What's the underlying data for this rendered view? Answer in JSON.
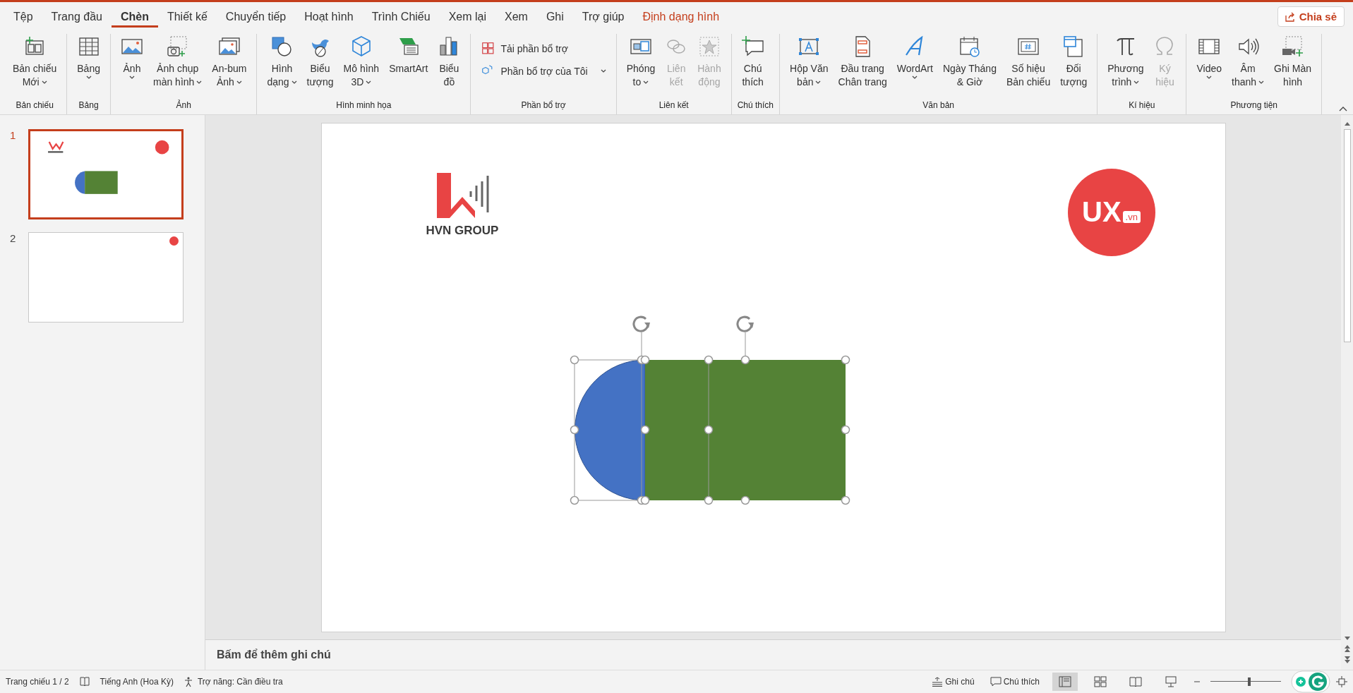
{
  "menu_tabs": [
    {
      "label": "Tệp",
      "selected": false,
      "kind": "normal"
    },
    {
      "label": "Trang đầu",
      "selected": false,
      "kind": "normal"
    },
    {
      "label": "Chèn",
      "selected": true,
      "kind": "normal"
    },
    {
      "label": "Thiết kế",
      "selected": false,
      "kind": "normal"
    },
    {
      "label": "Chuyển tiếp",
      "selected": false,
      "kind": "normal"
    },
    {
      "label": "Hoạt hình",
      "selected": false,
      "kind": "normal"
    },
    {
      "label": "Trình Chiếu",
      "selected": false,
      "kind": "normal"
    },
    {
      "label": "Xem lại",
      "selected": false,
      "kind": "normal"
    },
    {
      "label": "Xem",
      "selected": false,
      "kind": "normal"
    },
    {
      "label": "Ghi",
      "selected": false,
      "kind": "normal"
    },
    {
      "label": "Trợ giúp",
      "selected": false,
      "kind": "normal"
    },
    {
      "label": "Định dạng hình",
      "selected": false,
      "kind": "contextual"
    }
  ],
  "share_button": "Chia sẻ",
  "ribbon": {
    "groups": [
      {
        "label": "Bản chiếu",
        "items": [
          {
            "kind": "large",
            "lines": [
              "Bản chiếu",
              "Mới"
            ],
            "dropdown": true,
            "disabled": false
          }
        ]
      },
      {
        "label": "Bảng",
        "items": [
          {
            "kind": "large",
            "lines": [
              "Bảng"
            ],
            "dropdown": true,
            "disabled": false
          }
        ]
      },
      {
        "label": "Ảnh",
        "items": [
          {
            "kind": "large",
            "lines": [
              "Ảnh"
            ],
            "dropdown": true,
            "disabled": false
          },
          {
            "kind": "large",
            "lines": [
              "Ảnh chụp",
              "màn hình"
            ],
            "dropdown": true,
            "disabled": false
          },
          {
            "kind": "large",
            "lines": [
              "An-bum",
              "Ảnh"
            ],
            "dropdown": true,
            "disabled": false
          }
        ]
      },
      {
        "label": "Hình minh họa",
        "items": [
          {
            "kind": "large",
            "lines": [
              "Hình",
              "dạng"
            ],
            "dropdown": true,
            "disabled": false
          },
          {
            "kind": "large",
            "lines": [
              "Biểu",
              "tượng"
            ],
            "dropdown": false,
            "disabled": false
          },
          {
            "kind": "large",
            "lines": [
              "Mô hình",
              "3D"
            ],
            "dropdown": true,
            "disabled": false
          },
          {
            "kind": "large",
            "lines": [
              "SmartArt"
            ],
            "dropdown": false,
            "disabled": false
          },
          {
            "kind": "large",
            "lines": [
              "Biểu",
              "đồ"
            ],
            "dropdown": false,
            "disabled": false
          }
        ]
      },
      {
        "label": "Phần bổ trợ",
        "items": [
          {
            "kind": "small",
            "lines": [
              "Tải phần bổ trợ"
            ],
            "dropdown": false,
            "disabled": false
          },
          {
            "kind": "small",
            "lines": [
              "Phần bổ trợ của Tôi"
            ],
            "dropdown": true,
            "disabled": false
          }
        ]
      },
      {
        "label": "Liên kết",
        "items": [
          {
            "kind": "large",
            "lines": [
              "Phóng",
              "to"
            ],
            "dropdown": true,
            "disabled": false
          },
          {
            "kind": "large",
            "lines": [
              "Liên",
              "kết"
            ],
            "dropdown": false,
            "disabled": true
          },
          {
            "kind": "large",
            "lines": [
              "Hành",
              "động"
            ],
            "dropdown": false,
            "disabled": true
          }
        ]
      },
      {
        "label": "Chú thích",
        "items": [
          {
            "kind": "large",
            "lines": [
              "Chú",
              "thích"
            ],
            "dropdown": false,
            "disabled": false
          }
        ]
      },
      {
        "label": "Văn bản",
        "items": [
          {
            "kind": "large",
            "lines": [
              "Hộp Văn",
              "bản"
            ],
            "dropdown": true,
            "disabled": false
          },
          {
            "kind": "large",
            "lines": [
              "Đầu trang",
              "Chân trang"
            ],
            "dropdown": false,
            "disabled": false
          },
          {
            "kind": "large",
            "lines": [
              "WordArt"
            ],
            "dropdown": true,
            "disabled": false
          },
          {
            "kind": "large",
            "lines": [
              "Ngày Tháng",
              "& Giờ"
            ],
            "dropdown": false,
            "disabled": false
          },
          {
            "kind": "large",
            "lines": [
              "Số hiệu",
              "Bản chiếu"
            ],
            "dropdown": false,
            "disabled": false
          },
          {
            "kind": "large",
            "lines": [
              "Đối",
              "tượng"
            ],
            "dropdown": false,
            "disabled": false
          }
        ]
      },
      {
        "label": "Kí hiệu",
        "items": [
          {
            "kind": "large",
            "lines": [
              "Phương",
              "trình"
            ],
            "dropdown": true,
            "disabled": false
          },
          {
            "kind": "large",
            "lines": [
              "Ký",
              "hiệu"
            ],
            "dropdown": false,
            "disabled": true
          }
        ]
      },
      {
        "label": "Phương tiện",
        "items": [
          {
            "kind": "large",
            "lines": [
              "Video"
            ],
            "dropdown": true,
            "disabled": false
          },
          {
            "kind": "large",
            "lines": [
              "Âm",
              "thanh"
            ],
            "dropdown": true,
            "disabled": false
          },
          {
            "kind": "large",
            "lines": [
              "Ghi Màn",
              "hình"
            ],
            "dropdown": false,
            "disabled": false
          }
        ]
      }
    ]
  },
  "thumbnails": [
    {
      "number": "1",
      "selected": true
    },
    {
      "number": "2",
      "selected": false
    }
  ],
  "slide": {
    "left_logo_text": "HVN GROUP",
    "right_logo_text": "UX",
    "right_logo_tag": ".vn"
  },
  "notes_placeholder": "Bấm để thêm ghi chú",
  "status_bar": {
    "slide_indicator": "Trang chiếu 1 / 2",
    "language": "Tiếng Anh (Hoa Kỳ)",
    "accessibility": "Trợ năng: Cần điều tra",
    "notes_button": "Ghi chú",
    "comments_button": "Chú thích",
    "views": [
      {
        "selected": true
      },
      {
        "selected": false
      },
      {
        "selected": false
      },
      {
        "selected": false
      }
    ],
    "zoom": {
      "level": 0.55
    }
  }
}
